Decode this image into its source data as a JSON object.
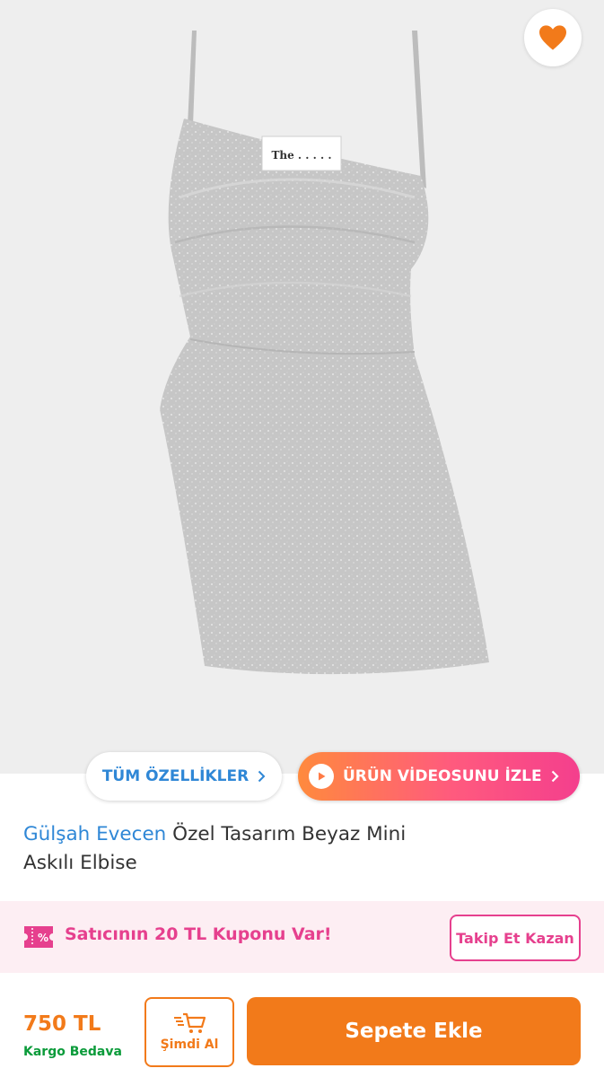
{
  "product_image": {
    "alt": "Gülşah Evecen Özel Tasarım Beyaz Mini Askılı Elbise",
    "label_text": "The . . . . .",
    "favorite_icon": "heart-icon",
    "colors": {
      "background": "#eeeeee",
      "dress": "#c7c7c7",
      "favorite": "#f27a1a"
    }
  },
  "actions": {
    "all_features_label": "TÜM ÖZELLİKLER",
    "all_features_icon": "chevron-right-icon",
    "video_label": "ÜRÜN VİDEOSUNU İZLE",
    "video_icon": "play-icon"
  },
  "product": {
    "brand": "Gülşah Evecen",
    "name_line1": "Özel Tasarım Beyaz Mini",
    "name_line2": "Askılı Elbise"
  },
  "coupon": {
    "icon": "coupon-icon",
    "text": "Satıcının 20 TL Kuponu Var!",
    "follow_label": "Takip Et Kazan"
  },
  "purchase": {
    "price": "750 TL",
    "shipping": "Kargo Bedava",
    "buy_now_label": "Şimdi Al",
    "buy_now_icon": "fast-cart-icon",
    "add_to_cart_label": "Sepete Ekle"
  },
  "colors": {
    "brand_orange": "#f27a1a",
    "link_blue": "#2f87d6",
    "coupon_pink": "#e6408e",
    "free_shipping_green": "#0b9b3a"
  }
}
